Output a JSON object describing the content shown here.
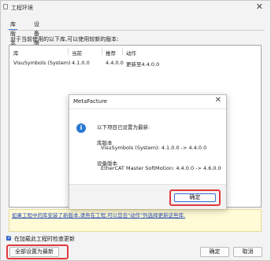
{
  "window": {
    "title": "工程环境"
  },
  "tabs": [
    {
      "label": "库版本",
      "active": true
    },
    {
      "label": "设备版本",
      "active": false
    }
  ],
  "intro": "对于当前使用的以下库,可以使用较新的版本:",
  "table": {
    "headers": [
      "库",
      "当前",
      "推荐",
      "动作"
    ],
    "rows": [
      {
        "name": "VisuSymbols (System)",
        "current": "4.1.0.0",
        "recommended": "4.4.0.0",
        "action": "更新至4.4.0.0"
      }
    ]
  },
  "warning": "如果工程中的库安装了新版本,请务在工程,可以您击\"动作\"列选择更新这些库.",
  "checkbox": {
    "label": "在加载此工程时检查更新",
    "checked": true
  },
  "buttons": {
    "set_all": "全部设置为最新",
    "ok": "确定",
    "cancel": "取消"
  },
  "dialog": {
    "title": "MetaFacture",
    "heading": "以下项目已设置为最新:",
    "lib_section": "库版本",
    "lib_item": "VisuSymbols (System): 4.1.0.0 -> 4.4.0.0",
    "dev_section": "设备版本",
    "dev_item": "EtherCAT Master SoftMotion: 4.4.0.0 -> 4.6.0.0",
    "ok": "确定"
  },
  "colors": {
    "highlight": "#e0393e",
    "accent": "#2a78d4",
    "warning_bg": "#fffbd6"
  }
}
